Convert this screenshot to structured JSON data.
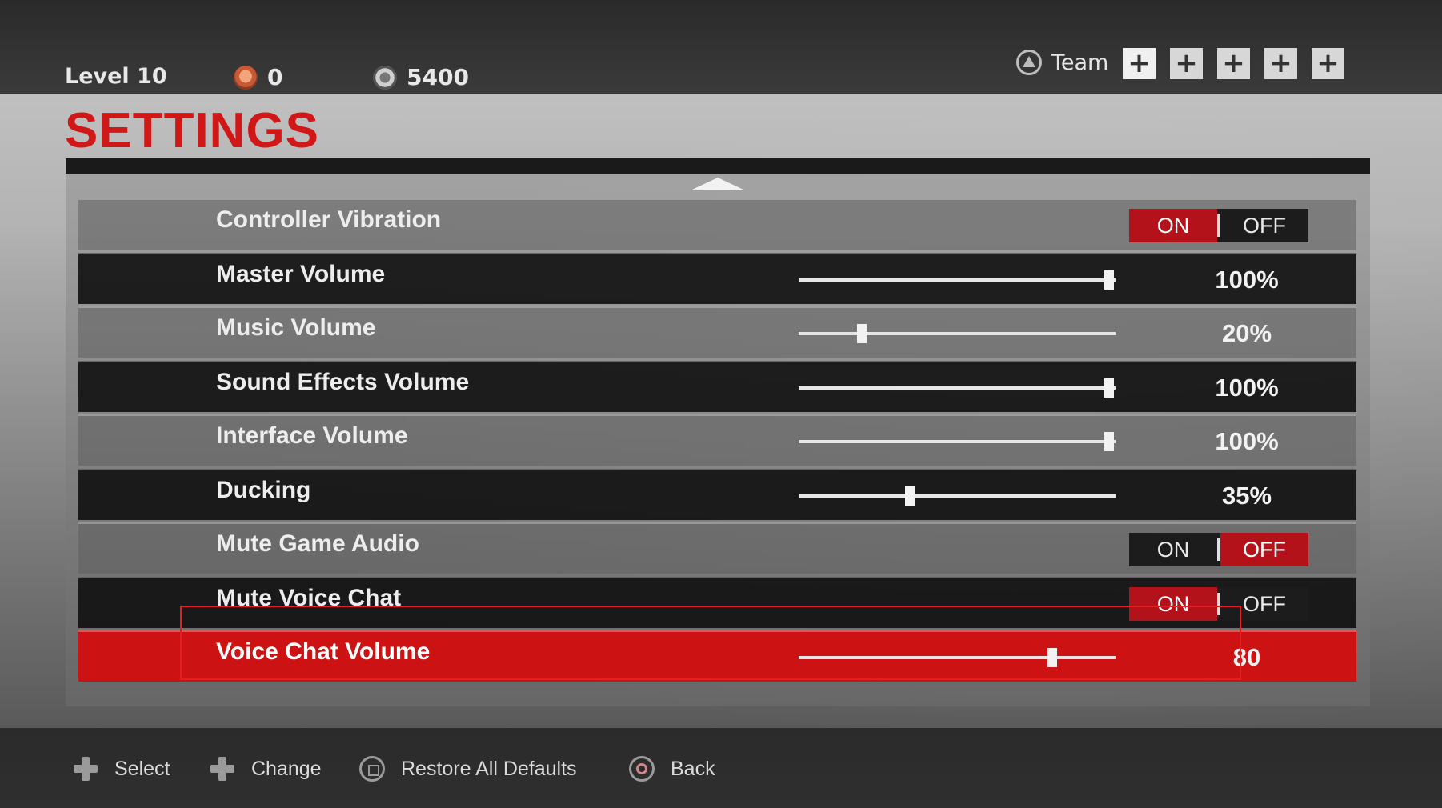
{
  "header": {
    "level": "Level 10",
    "crowns": "0",
    "currency": "5400",
    "team_label": "Team",
    "team_slots": [
      "+",
      "+",
      "+",
      "+",
      "+"
    ]
  },
  "title": "SETTINGS",
  "settings": [
    {
      "label": "Controller Vibration",
      "type": "toggle",
      "on": "ON",
      "off": "OFF",
      "value": "ON"
    },
    {
      "label": "Master Volume",
      "type": "slider",
      "level": 1.0,
      "value": "100%"
    },
    {
      "label": "Music Volume",
      "type": "slider",
      "level": 0.2,
      "value": "20%"
    },
    {
      "label": "Sound Effects Volume",
      "type": "slider",
      "level": 1.0,
      "value": "100%"
    },
    {
      "label": "Interface Volume",
      "type": "slider",
      "level": 1.0,
      "value": "100%"
    },
    {
      "label": "Ducking",
      "type": "slider",
      "level": 0.35,
      "value": "35%"
    },
    {
      "label": "Mute Game Audio",
      "type": "toggle",
      "on": "ON",
      "off": "OFF",
      "value": "OFF"
    },
    {
      "label": "Mute Voice Chat",
      "type": "toggle",
      "on": "ON",
      "off": "OFF",
      "value": "ON"
    },
    {
      "label": "Voice Chat Volume",
      "type": "slider",
      "level": 0.8,
      "value": "80",
      "selected": true
    }
  ],
  "footer": {
    "select": "Select",
    "change": "Change",
    "restore": "Restore All Defaults",
    "back": "Back"
  },
  "colors": {
    "accent": "#cc1212",
    "title": "#d11818"
  }
}
